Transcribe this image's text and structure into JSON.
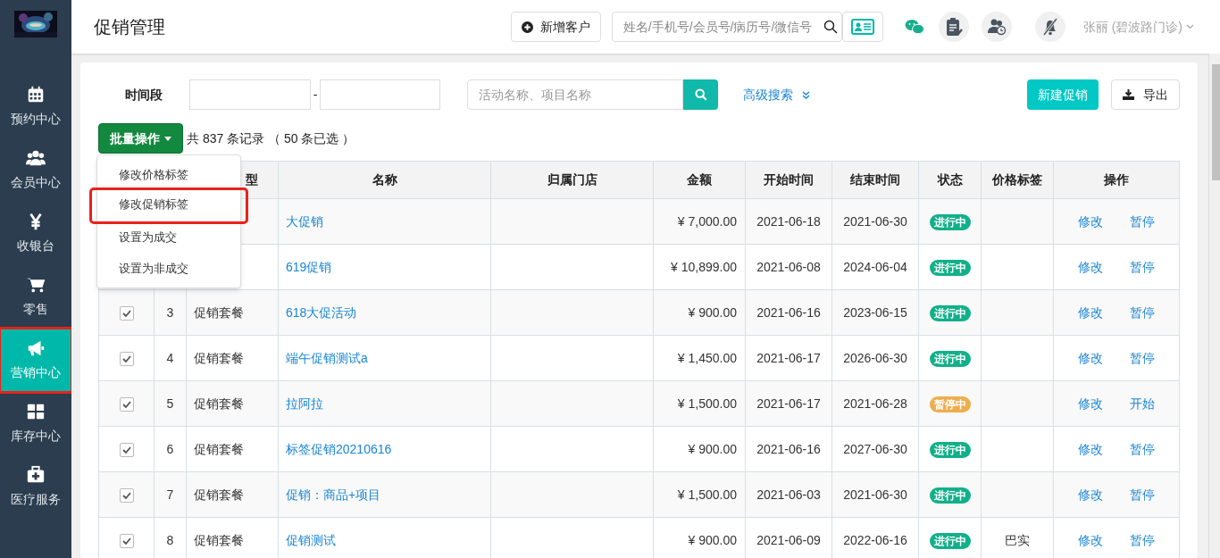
{
  "sidebar": {
    "items": [
      {
        "label": "预约中心",
        "selected": false,
        "highlighted": false
      },
      {
        "label": "会员中心",
        "selected": false,
        "highlighted": false
      },
      {
        "label": "收银台",
        "selected": false,
        "highlighted": false
      },
      {
        "label": "零售",
        "selected": false,
        "highlighted": false
      },
      {
        "label": "营销中心",
        "selected": true,
        "highlighted": true
      },
      {
        "label": "库存中心",
        "selected": false,
        "highlighted": false
      },
      {
        "label": "医疗服务",
        "selected": false,
        "highlighted": false
      }
    ]
  },
  "header": {
    "title": "促销管理",
    "add_customer": "新增客户",
    "search_placeholder": "姓名/手机号/会员号/病历号/微信号",
    "user": "张丽 (碧波路门诊)"
  },
  "filters": {
    "period_label": "时间段",
    "date_separator": "-",
    "keyword_placeholder": "活动名称、项目名称",
    "advanced_search": "高级搜索",
    "new_button": "新建促销",
    "export_button": "导出"
  },
  "batch": {
    "button": "批量操作",
    "summary": "共 837 条记录 （ 50 条已选 ）",
    "menu": [
      {
        "label": "修改价格标签",
        "highlighted": false
      },
      {
        "label": "修改促销标签",
        "highlighted": true
      },
      {
        "label": "设置为成交",
        "highlighted": false
      },
      {
        "label": "设置为非成交",
        "highlighted": false
      }
    ]
  },
  "table": {
    "columns": [
      "型",
      "名称",
      "归属门店",
      "金额",
      "开始时间",
      "结束时间",
      "状态",
      "价格标签",
      "操作"
    ],
    "rows": [
      {
        "name": "大促销",
        "amount": "¥ 7,000.00",
        "start": "2021-06-18",
        "end": "2021-06-30",
        "status": {
          "text": "进行中",
          "kind": "running"
        },
        "actions": [
          "修改",
          "暂停"
        ]
      },
      {
        "name": "619促销",
        "amount": "¥ 10,899.00",
        "start": "2021-06-08",
        "end": "2024-06-04",
        "status": {
          "text": "进行中",
          "kind": "running"
        },
        "actions": [
          "修改",
          "暂停"
        ]
      },
      {
        "checked": true,
        "index": "3",
        "type": "促销套餐",
        "name": "618大促活动",
        "amount": "¥ 900.00",
        "start": "2021-06-16",
        "end": "2023-06-15",
        "status": {
          "text": "进行中",
          "kind": "running"
        },
        "actions": [
          "修改",
          "暂停"
        ]
      },
      {
        "checked": true,
        "index": "4",
        "type": "促销套餐",
        "name": "端午促销测试a",
        "amount": "¥ 1,450.00",
        "start": "2021-06-17",
        "end": "2026-06-30",
        "status": {
          "text": "进行中",
          "kind": "running"
        },
        "actions": [
          "修改",
          "暂停"
        ]
      },
      {
        "checked": true,
        "index": "5",
        "type": "促销套餐",
        "name": "拉阿拉",
        "amount": "¥ 1,500.00",
        "start": "2021-06-17",
        "end": "2021-06-28",
        "status": {
          "text": "暂停中",
          "kind": "paused"
        },
        "actions": [
          "修改",
          "开始"
        ]
      },
      {
        "checked": true,
        "index": "6",
        "type": "促销套餐",
        "name": "标签促销20210616",
        "amount": "¥ 900.00",
        "start": "2021-06-16",
        "end": "2027-06-30",
        "status": {
          "text": "进行中",
          "kind": "running"
        },
        "actions": [
          "修改",
          "暂停"
        ]
      },
      {
        "checked": true,
        "index": "7",
        "type": "促销套餐",
        "name": "促销：商品+项目",
        "amount": "¥ 1,500.00",
        "start": "2021-06-03",
        "end": "2021-06-30",
        "status": {
          "text": "进行中",
          "kind": "running"
        },
        "actions": [
          "修改",
          "暂停"
        ]
      },
      {
        "checked": true,
        "index": "8",
        "type": "促销套餐",
        "name": "促销测试",
        "amount": "¥ 900.00",
        "start": "2021-06-09",
        "end": "2022-06-16",
        "status": {
          "text": "进行中",
          "kind": "running"
        },
        "price_tag": "巴实",
        "actions": [
          "修改",
          "暂停"
        ]
      }
    ]
  }
}
